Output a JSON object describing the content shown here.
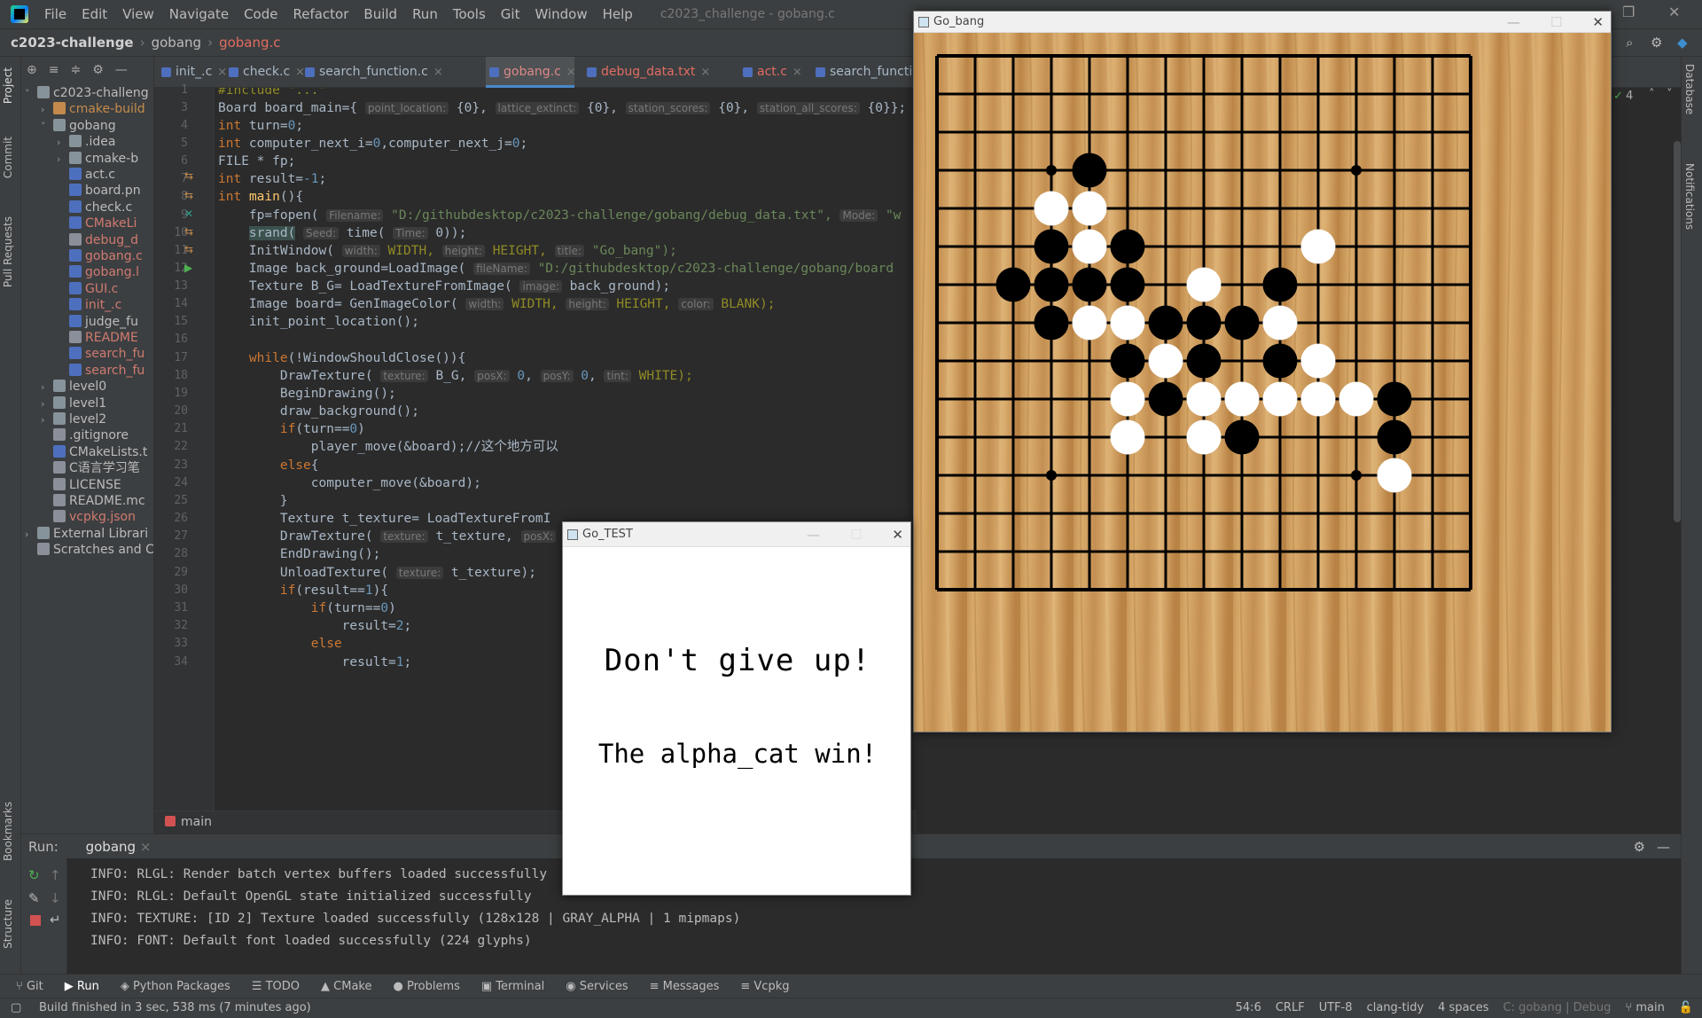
{
  "menu": [
    "File",
    "Edit",
    "View",
    "Navigate",
    "Code",
    "Refactor",
    "Build",
    "Run",
    "Tools",
    "Git",
    "Window",
    "Help"
  ],
  "window_title": "c2023_challenge - gobang.c",
  "breadcrumb": [
    "c2023-challenge",
    "gobang",
    "gobang.c"
  ],
  "project_tree": [
    {
      "label": "c2023-challeng",
      "depth": 0,
      "type": "folder",
      "open": true
    },
    {
      "label": "cmake-build",
      "depth": 1,
      "type": "folder-orange",
      "open": false
    },
    {
      "label": "gobang",
      "depth": 1,
      "type": "folder",
      "open": true
    },
    {
      "label": ".idea",
      "depth": 2,
      "type": "folder",
      "open": false
    },
    {
      "label": "cmake-b",
      "depth": 2,
      "type": "folder",
      "open": false
    },
    {
      "label": "act.c",
      "depth": 2,
      "type": "c"
    },
    {
      "label": "board.pn",
      "depth": 2,
      "type": "c"
    },
    {
      "label": "check.c",
      "depth": 2,
      "type": "c"
    },
    {
      "label": "CMakeLi",
      "depth": 2,
      "type": "c"
    },
    {
      "label": "debug_d",
      "depth": 2,
      "type": "txt"
    },
    {
      "label": "gobang.c",
      "depth": 2,
      "type": "c"
    },
    {
      "label": "gobang.l",
      "depth": 2,
      "type": "c"
    },
    {
      "label": "GUI.c",
      "depth": 2,
      "type": "c"
    },
    {
      "label": "init_.c",
      "depth": 2,
      "type": "c"
    },
    {
      "label": "judge_fu",
      "depth": 2,
      "type": "c"
    },
    {
      "label": "README",
      "depth": 2,
      "type": "txt"
    },
    {
      "label": "search_fu",
      "depth": 2,
      "type": "c"
    },
    {
      "label": "search_fu",
      "depth": 2,
      "type": "c"
    },
    {
      "label": "level0",
      "depth": 1,
      "type": "folder",
      "open": false
    },
    {
      "label": "level1",
      "depth": 1,
      "type": "folder",
      "open": false
    },
    {
      "label": "level2",
      "depth": 1,
      "type": "folder",
      "open": false
    },
    {
      "label": ".gitignore",
      "depth": 1,
      "type": "txt"
    },
    {
      "label": "CMakeLists.t",
      "depth": 1,
      "type": "c"
    },
    {
      "label": "C语言学习笔",
      "depth": 1,
      "type": "txt"
    },
    {
      "label": "LICENSE",
      "depth": 1,
      "type": "txt"
    },
    {
      "label": "README.mc",
      "depth": 1,
      "type": "txt"
    },
    {
      "label": "vcpkg.json",
      "depth": 1,
      "type": "txt"
    },
    {
      "label": "External Librari",
      "depth": 0,
      "type": "lib",
      "open": false
    },
    {
      "label": "Scratches and C",
      "depth": 0,
      "type": "scratch"
    }
  ],
  "editor_tabs": [
    "init_.c",
    "check.c",
    "search_function.c",
    "gobang.c",
    "debug_data.txt",
    "act.c",
    "search_function"
  ],
  "line_numbers": [
    "1",
    "3",
    "4",
    "5",
    "6",
    "7",
    "8",
    "9",
    "10",
    "11",
    "12",
    "13",
    "14",
    "15",
    "16",
    "17",
    "18",
    "19",
    "20",
    "21",
    "22",
    "23",
    "24",
    "25",
    "26",
    "27",
    "28",
    "29",
    "30",
    "31",
    "32",
    "33",
    "34"
  ],
  "code": {
    "l1": "#include \"...\"",
    "l3a": "Board board_main={",
    "h_point": "point_location:",
    "h_lattice": "lattice_extinct:",
    "h_station": "station_scores:",
    "h_all": "station_all_scores:",
    "zero": "{0}",
    "l4": "int turn=0;",
    "l5": "int computer_next_i=0,computer_next_j=0;",
    "l6": "FILE * fp;",
    "l7": "int result=-1;",
    "l8": "int main(){",
    "l9a": "fp=fopen(",
    "h_filename": "Filename:",
    "l9b": "\"D:/githubdesktop/c2023-challenge/gobang/debug_data.txt\",",
    "h_mode": "Mode:",
    "l9c": "\"w",
    "l10a": "srand(",
    "h_seed": "Seed:",
    "l10b": "time(",
    "h_time": "Time:",
    "l10c": "0));",
    "l11a": "InitWindow(",
    "h_width": "width:",
    "l11b": "WIDTH,",
    "h_height": "height:",
    "l11c": "HEIGHT,",
    "h_title": "title:",
    "l11d": "\"Go_bang\");",
    "l12a": "Image back_ground=LoadImage(",
    "h_fileName": "fileName:",
    "l12b": "\"D:/githubdesktop/c2023-challenge/gobang/board",
    "l13a": "Texture B_G= LoadTextureFromImage(",
    "h_image": "image:",
    "l13b": "back_ground);",
    "l14a": "Image board= GenImageColor(",
    "h_color": "color:",
    "l14b": "BLANK);",
    "l15": "init_point_location();",
    "l17": "while(!WindowShouldClose()){",
    "l18a": "DrawTexture(",
    "h_texture": "texture:",
    "l18b": "B_G,",
    "h_posx": "posX:",
    "h_posy": "posY:",
    "h_tint": "tint:",
    "l18c": "WHITE);",
    "l19": "BeginDrawing();",
    "l20": "draw_background();",
    "l21": "if(turn==0)",
    "l22": "player_move(&board);//这个地方可以",
    "l23": "else{",
    "l24": "computer_move(&board);",
    "l25": "}",
    "l26": "Texture t_texture= LoadTextureFromI",
    "l27a": "DrawTexture(",
    "l27b": "t_texture,",
    "l28": "EndDrawing();",
    "l29a": "UnloadTexture(",
    "l29b": "t_texture);",
    "l30": "if(result==1){",
    "l31": "if(turn==0)",
    "l32": "result=2;",
    "l33": "else",
    "l34": "result=1;"
  },
  "editor_breadcrumb": "main",
  "inspection_count": "4",
  "run": {
    "label": "Run:",
    "config": "gobang",
    "log": [
      "INFO: RLGL: Render batch vertex buffers loaded successfully",
      "INFO: RLGL: Default OpenGL state initialized successfully",
      "INFO: TEXTURE: [ID 2] Texture loaded successfully (128x128 | GRAY_ALPHA | 1 mipmaps)",
      "INFO: FONT: Default font loaded successfully (224 glyphs)"
    ]
  },
  "tool_windows": [
    "Git",
    "Run",
    "Python Packages",
    "TODO",
    "CMake",
    "Problems",
    "Terminal",
    "Services",
    "Messages",
    "Vcpkg"
  ],
  "left_tabs": [
    "Project",
    "Commit",
    "Pull Requests",
    "Bookmarks",
    "Structure"
  ],
  "right_tabs": [
    "Database",
    "Notifications"
  ],
  "status": {
    "message": "Build finished in 3 sec, 538 ms (7 minutes ago)",
    "position": "54:6",
    "line_sep": "CRLF",
    "encoding": "UTF-8",
    "linter": "clang-tidy",
    "indent": "4 spaces",
    "context": "C: gobang | Debug",
    "branch": "main"
  },
  "go_test": {
    "title": "Go_TEST",
    "line1": "Don't give up!",
    "line2": "The alpha_cat win!"
  },
  "go_bang": {
    "title": "Go_bang",
    "board_size": 15,
    "board_color": "#c89a55",
    "star_points": [
      [
        3,
        3
      ],
      [
        3,
        11
      ],
      [
        11,
        3
      ],
      [
        11,
        11
      ]
    ],
    "black": [
      [
        3,
        4
      ],
      [
        5,
        3
      ],
      [
        5,
        5
      ],
      [
        6,
        2
      ],
      [
        6,
        3
      ],
      [
        6,
        4
      ],
      [
        6,
        5
      ],
      [
        6,
        9
      ],
      [
        7,
        3
      ],
      [
        7,
        6
      ],
      [
        7,
        7
      ],
      [
        7,
        8
      ],
      [
        8,
        5
      ],
      [
        8,
        7
      ],
      [
        8,
        9
      ],
      [
        9,
        6
      ],
      [
        9,
        12
      ],
      [
        10,
        8
      ],
      [
        10,
        12
      ]
    ],
    "white": [
      [
        4,
        3
      ],
      [
        4,
        4
      ],
      [
        5,
        4
      ],
      [
        5,
        10
      ],
      [
        6,
        7
      ],
      [
        7,
        4
      ],
      [
        7,
        5
      ],
      [
        7,
        9
      ],
      [
        8,
        6
      ],
      [
        8,
        10
      ],
      [
        9,
        5
      ],
      [
        9,
        7
      ],
      [
        9,
        8
      ],
      [
        9,
        9
      ],
      [
        9,
        10
      ],
      [
        9,
        11
      ],
      [
        10,
        5
      ],
      [
        10,
        7
      ],
      [
        11,
        12
      ]
    ]
  }
}
